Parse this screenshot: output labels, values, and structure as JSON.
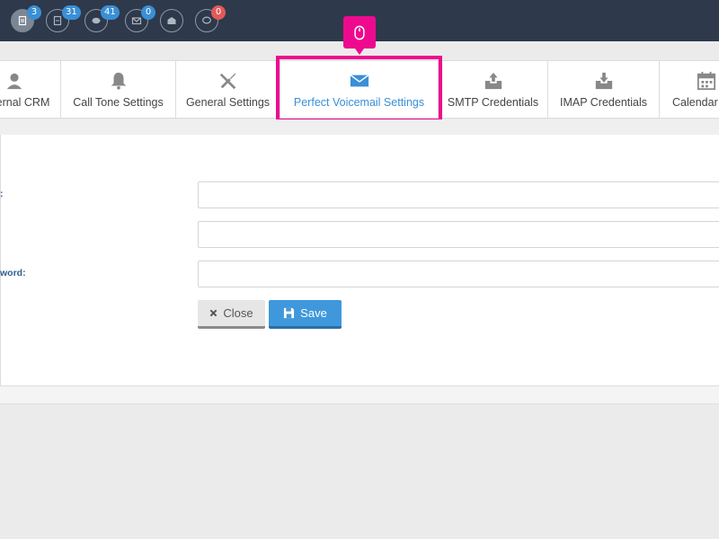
{
  "topbar": {
    "icons": [
      {
        "name": "document-icon",
        "badge": "3",
        "badge_color": "#3a8fd6"
      },
      {
        "name": "file-icon",
        "badge": "31",
        "badge_color": "#3a8fd6"
      },
      {
        "name": "chat-bubbles-icon",
        "badge": "41",
        "badge_color": "#3a8fd6"
      },
      {
        "name": "envelope-icon",
        "badge": "0",
        "badge_color": "#3a8fd6"
      },
      {
        "name": "open-envelope-icon",
        "badge": "",
        "badge_color": ""
      },
      {
        "name": "speech-bubble-icon",
        "badge": "0",
        "badge_color": "#e05a5a"
      }
    ]
  },
  "tabs": [
    {
      "label": "ernal CRM",
      "icon": "user-icon"
    },
    {
      "label": "Call Tone Settings",
      "icon": "bell-icon"
    },
    {
      "label": "General Settings",
      "icon": "tools-icon"
    },
    {
      "label": "Perfect Voicemail Settings",
      "icon": "envelope-icon",
      "active": true
    },
    {
      "label": "SMTP Credentials",
      "icon": "inbox-upload-icon"
    },
    {
      "label": "IMAP Credentials",
      "icon": "inbox-download-icon"
    },
    {
      "label": "Calendar",
      "icon": "calendar-icon"
    }
  ],
  "form": {
    "fields": [
      {
        "label": ":",
        "value": ""
      },
      {
        "label": "",
        "value": ""
      },
      {
        "label": "word:",
        "value": ""
      }
    ],
    "close_label": "Close",
    "save_label": "Save"
  },
  "colors": {
    "highlight": "#ee0a8f",
    "active_tab": "#3a8fd6",
    "topbar": "#2e3a4b",
    "save_button": "#3f98db"
  },
  "pointer": {
    "icon": "mouse-icon"
  }
}
